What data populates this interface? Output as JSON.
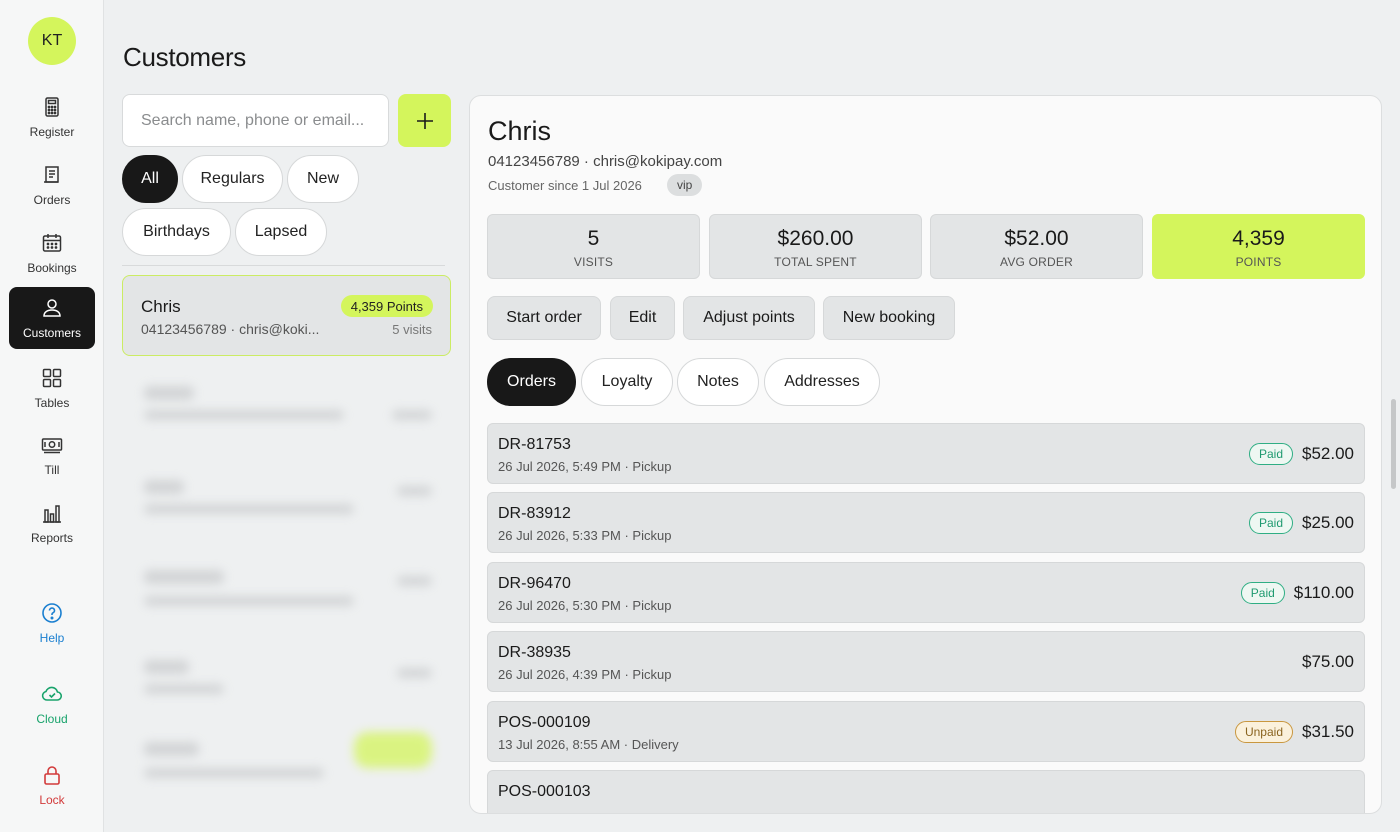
{
  "user": {
    "initials": "KT"
  },
  "sidebar": {
    "items": [
      {
        "label": "Register",
        "icon": "calculator-icon"
      },
      {
        "label": "Orders",
        "icon": "receipt-icon"
      },
      {
        "label": "Bookings",
        "icon": "calendar-icon"
      },
      {
        "label": "Customers",
        "icon": "person-icon",
        "active": true
      },
      {
        "label": "Tables",
        "icon": "grid-icon"
      },
      {
        "label": "Till",
        "icon": "cash-icon"
      },
      {
        "label": "Reports",
        "icon": "bar-chart-icon"
      }
    ],
    "help": "Help",
    "cloud": "Cloud",
    "lock": "Lock"
  },
  "page": {
    "title": "Customers"
  },
  "search": {
    "placeholder": "Search name, phone or email..."
  },
  "filters": [
    "All",
    "Regulars",
    "New",
    "Birthdays",
    "Lapsed"
  ],
  "customer_list": [
    {
      "name": "Chris",
      "points": "4,359 Points",
      "contact": "04123456789 · chris@koki...",
      "visits": "5 visits"
    }
  ],
  "detail": {
    "name": "Chris",
    "contact": "04123456789 · chris@kokipay.com",
    "since": "Customer since 1 Jul 2026",
    "tag": "vip",
    "stats": [
      {
        "value": "5",
        "label": "VISITS"
      },
      {
        "value": "$260.00",
        "label": "TOTAL SPENT"
      },
      {
        "value": "$52.00",
        "label": "AVG ORDER"
      },
      {
        "value": "4,359",
        "label": "POINTS"
      }
    ],
    "actions": [
      "Start order",
      "Edit",
      "Adjust points",
      "New booking"
    ],
    "tabs": [
      "Orders",
      "Loyalty",
      "Notes",
      "Addresses"
    ],
    "orders": [
      {
        "id": "DR-81753",
        "meta": "26 Jul 2026, 5:49 PM · Pickup",
        "status": "Paid",
        "amount": "$52.00"
      },
      {
        "id": "DR-83912",
        "meta": "26 Jul 2026, 5:33 PM · Pickup",
        "status": "Paid",
        "amount": "$25.00"
      },
      {
        "id": "DR-96470",
        "meta": "26 Jul 2026, 5:30 PM · Pickup",
        "status": "Paid",
        "amount": "$110.00"
      },
      {
        "id": "DR-38935",
        "meta": "26 Jul 2026, 4:39 PM · Pickup",
        "status": "",
        "amount": "$75.00"
      },
      {
        "id": "POS-000109",
        "meta": "13 Jul 2026, 8:55 AM · Delivery",
        "status": "Unpaid",
        "amount": "$31.50"
      },
      {
        "id": "POS-000103",
        "meta": "",
        "status": "",
        "amount": ""
      }
    ]
  },
  "colors": {
    "accent": "#d4f55c",
    "active_nav": "#181818",
    "paid": "#2fae84",
    "unpaid": "#c9973f"
  }
}
